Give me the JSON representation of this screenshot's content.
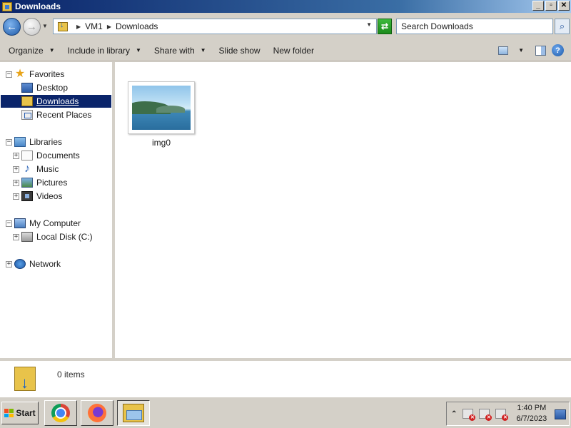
{
  "window": {
    "title": "Downloads"
  },
  "titlebar_buttons": {
    "minimize": "_",
    "maximize": "▫",
    "close": "✕"
  },
  "address": {
    "crumbs": [
      "VM1",
      "Downloads"
    ],
    "search_placeholder": "Search Downloads"
  },
  "toolbar": {
    "organize": "Organize",
    "include_in_library": "Include in library",
    "share_with": "Share with",
    "slide_show": "Slide show",
    "new_folder": "New folder"
  },
  "nav": {
    "favorites": "Favorites",
    "desktop": "Desktop",
    "downloads": "Downloads",
    "recent_places": "Recent Places",
    "libraries": "Libraries",
    "documents": "Documents",
    "music": "Music",
    "pictures": "Pictures",
    "videos": "Videos",
    "my_computer": "My Computer",
    "local_disk": "Local Disk (C:)",
    "network": "Network"
  },
  "files": [
    {
      "name": "img0",
      "type": "image"
    }
  ],
  "details": {
    "count": "0 items"
  },
  "taskbar": {
    "start": "Start",
    "apps": [
      "chrome-icon",
      "firefox-icon",
      "explorer-icon"
    ],
    "time": "1:40 PM",
    "date": "6/7/2023"
  },
  "colors": {
    "selection": "#0a246a",
    "window_bg": "#d4d0c8"
  }
}
